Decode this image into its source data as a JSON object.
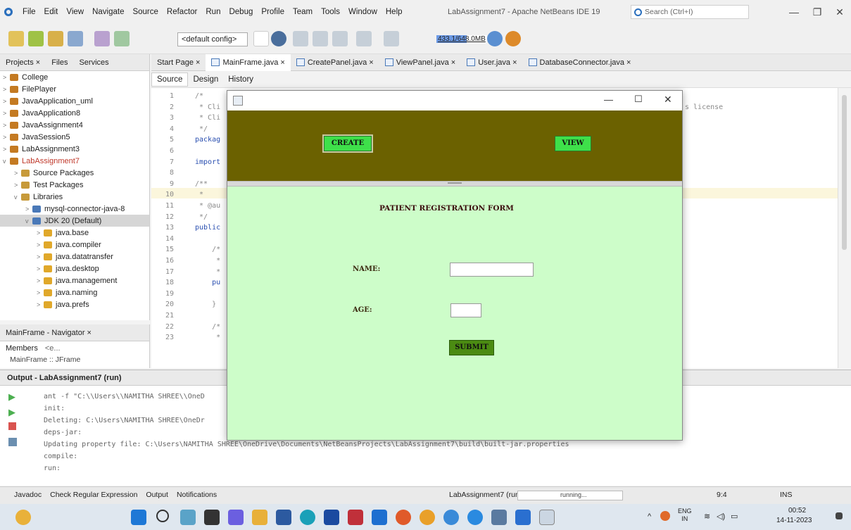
{
  "menubar": {
    "items": [
      "File",
      "Edit",
      "View",
      "Navigate",
      "Source",
      "Refactor",
      "Run",
      "Debug",
      "Profile",
      "Team",
      "Tools",
      "Window",
      "Help"
    ],
    "title": "LabAssignment7 - Apache NetBeans IDE 19",
    "search_placeholder": "Search (Ctrl+I)"
  },
  "toolbar": {
    "config": "<default config>",
    "memory": "433.1/648.0MB"
  },
  "projects": {
    "tabs": [
      "Projects ×",
      "Files",
      "Services"
    ],
    "items": [
      {
        "label": "College",
        "icon": "project-icon",
        "chev": ">"
      },
      {
        "label": "FilePlayer",
        "icon": "project-icon",
        "chev": ">"
      },
      {
        "label": "JavaApplication_uml",
        "icon": "project-icon",
        "chev": ">"
      },
      {
        "label": "JavaApplication8",
        "icon": "project-icon",
        "chev": ">"
      },
      {
        "label": "JavaAssignment4",
        "icon": "project-icon",
        "chev": ">"
      },
      {
        "label": "JavaSession5",
        "icon": "project-icon",
        "chev": ">"
      },
      {
        "label": "LabAssignment3",
        "icon": "project-icon",
        "chev": ">"
      },
      {
        "label": "LabAssignment7",
        "icon": "project-icon",
        "chev": "v"
      },
      {
        "label": "Source Packages",
        "icon": "package-icon",
        "chev": ">"
      },
      {
        "label": "Test Packages",
        "icon": "package-icon",
        "chev": ">"
      },
      {
        "label": "Libraries",
        "icon": "package-icon",
        "chev": "v"
      },
      {
        "label": "mysql-connector-java-8",
        "icon": "jar-icon",
        "chev": ">"
      },
      {
        "label": "JDK 20 (Default)",
        "icon": "jar-icon",
        "chev": "v"
      },
      {
        "label": "java.base",
        "icon": "module-icon",
        "chev": ">"
      },
      {
        "label": "java.compiler",
        "icon": "module-icon",
        "chev": ">"
      },
      {
        "label": "java.datatransfer",
        "icon": "module-icon",
        "chev": ">"
      },
      {
        "label": "java.desktop",
        "icon": "module-icon",
        "chev": ">"
      },
      {
        "label": "java.management",
        "icon": "module-icon",
        "chev": ">"
      },
      {
        "label": "java.naming",
        "icon": "module-icon",
        "chev": ">"
      },
      {
        "label": "java.prefs",
        "icon": "module-icon",
        "chev": ">"
      }
    ]
  },
  "navigator": {
    "title": "MainFrame - Navigator ×",
    "members": "Members",
    "filter": "<e...",
    "item": "MainFrame :: JFrame"
  },
  "editor": {
    "tabs": [
      "Start Page ×",
      "MainFrame.java ×",
      "CreatePanel.java ×",
      "ViewPanel.java ×",
      "User.java ×",
      "DatabaseConnector.java ×"
    ],
    "subtabs": [
      "Source",
      "Design",
      "History"
    ],
    "lines": [
      {
        "n": "1",
        "t": "/*"
      },
      {
        "n": "2",
        "t": " * Cli"
      },
      {
        "n": "3",
        "t": " * Cli"
      },
      {
        "n": "4",
        "t": " */"
      },
      {
        "n": "5",
        "t": "packag"
      },
      {
        "n": "6",
        "t": ""
      },
      {
        "n": "7",
        "t": "import"
      },
      {
        "n": "8",
        "t": ""
      },
      {
        "n": "9",
        "t": "/**"
      },
      {
        "n": "10",
        "t": " *"
      },
      {
        "n": "11",
        "t": " * @au"
      },
      {
        "n": "12",
        "t": " */"
      },
      {
        "n": "13",
        "t": "public"
      },
      {
        "n": "14",
        "t": ""
      },
      {
        "n": "15",
        "t": "    /*"
      },
      {
        "n": "16",
        "t": "     *"
      },
      {
        "n": "17",
        "t": "     *"
      },
      {
        "n": "18",
        "t": "    pu"
      },
      {
        "n": "19",
        "t": ""
      },
      {
        "n": "20",
        "t": "    }"
      },
      {
        "n": "21",
        "t": ""
      },
      {
        "n": "22",
        "t": "    /*"
      },
      {
        "n": "23",
        "t": "     *"
      }
    ],
    "license_fragment": "s license"
  },
  "output": {
    "title": "Output - LabAssignment7 (run)",
    "lines": [
      "ant -f \"C:\\\\Users\\\\NAMITHA SHREE\\\\OneD",
      "init:",
      "Deleting: C:\\Users\\NAMITHA SHREE\\OneDr",
      "deps-jar:",
      "Updating property file: C:\\Users\\NAMITHA SHREE\\OneDrive\\Documents\\NetBeansProjects\\LabAssignment7\\build\\built-jar.properties",
      "compile:",
      "run:"
    ]
  },
  "statusbar": {
    "items": [
      "Javadoc",
      "Check Regular Expression",
      "Output",
      "Notifications"
    ],
    "run": "LabAssignment7 (run)",
    "running": "running...",
    "pos": "9:4",
    "mode": "INS"
  },
  "taskbar": {
    "lang": "ENG",
    "lang2": "IN",
    "time": "00:52",
    "date": "14-11-2023"
  },
  "app": {
    "create_label": "CREATE",
    "view_label": "VIEW",
    "form_title": "PATIENT REGISTRATION FORM",
    "name_label": "NAME:",
    "age_label": "AGE:",
    "submit_label": "SUBMIT",
    "name_value": "",
    "age_value": ""
  },
  "colors": {
    "topbar": "#6b6100",
    "form_bg": "#cdfdc9",
    "button_green": "#3ee04a",
    "submit_green": "#4b8b12"
  }
}
